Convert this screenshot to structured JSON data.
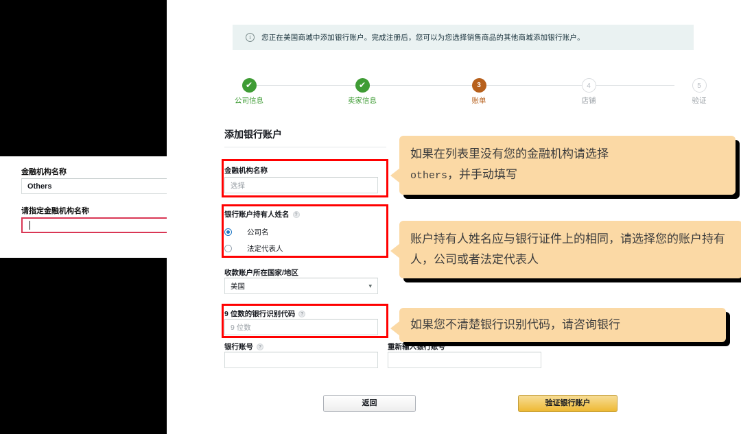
{
  "overlay": {
    "fi_name_label": "金融机构名称",
    "fi_name_value": "Others",
    "specify_label": "请指定金融机构名称",
    "specify_value": ""
  },
  "banner": {
    "icon": "info-circle-icon",
    "text": "您正在美国商城中添加银行账户。完成注册后，您可以为您选择销售商品的其他商城添加银行账户。"
  },
  "stepper": {
    "steps": [
      {
        "label": "公司信息",
        "marker": "✔",
        "state": "done"
      },
      {
        "label": "卖家信息",
        "marker": "✔",
        "state": "done"
      },
      {
        "label": "账单",
        "marker": "3",
        "state": "active"
      },
      {
        "label": "店铺",
        "marker": "4",
        "state": "todo"
      },
      {
        "label": "验证",
        "marker": "5",
        "state": "todo"
      }
    ]
  },
  "form": {
    "title": "添加银行账户",
    "fi_name": {
      "label": "金融机构名称",
      "placeholder": "选择"
    },
    "holder": {
      "label": "银行账户持有人姓名",
      "help": "?",
      "options": [
        {
          "label": "公司名",
          "selected": true
        },
        {
          "label": "法定代表人",
          "selected": false
        }
      ]
    },
    "country": {
      "label": "收款账户所在国家/地区",
      "value": "美国",
      "caret": "▾"
    },
    "routing": {
      "label": "9 位数的银行识别代码",
      "help": "?",
      "placeholder": "9 位数"
    },
    "account": {
      "label": "银行账号",
      "help": "?",
      "value": ""
    },
    "account_reenter": {
      "label": "重新输入银行账号",
      "value": ""
    }
  },
  "callouts": {
    "one_line1": "如果在列表里没有您的金融机构请选择",
    "one_mono": "others",
    "one_line2": "，并手动填写",
    "two": "账户持有人姓名应与银行证件上的相同，请选择您的账户持有人，公司或者法定代表人",
    "three": "如果您不清楚银行识别代码，请咨询银行"
  },
  "footer": {
    "back_label": "返回",
    "verify_label": "验证银行账户"
  },
  "colors": {
    "highlight_red": "#ff0000",
    "callout_bg": "#fbd9a5",
    "step_done": "#3f9c35",
    "step_active": "#b7601c",
    "banner_bg": "#eaf2f2",
    "verify_button": "#eeb933",
    "focus_border": "#d93654",
    "radio_selected": "#1e77c4"
  }
}
